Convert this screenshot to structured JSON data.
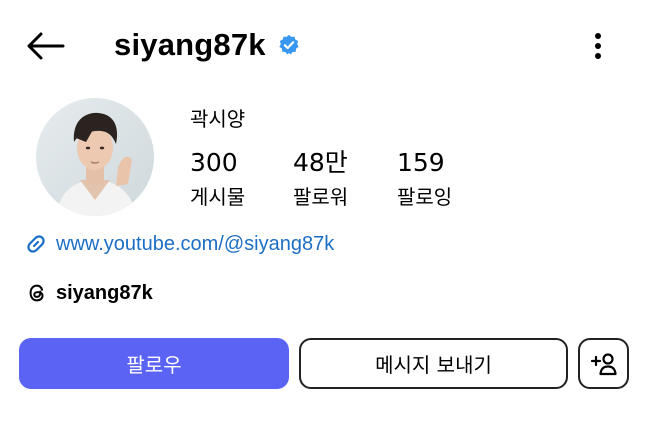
{
  "header": {
    "username": "siyang87k",
    "back_icon": "arrow-left-icon",
    "verified_icon": "verified-badge-icon",
    "more_icon": "more-vertical-icon"
  },
  "profile": {
    "display_name": "곽시양",
    "stats": [
      {
        "value": "300",
        "label": "게시물"
      },
      {
        "value": "48만",
        "label": "팔로워"
      },
      {
        "value": "159",
        "label": "팔로잉"
      }
    ],
    "link": "www.youtube.com/@siyang87k",
    "threads_handle": "siyang87k"
  },
  "actions": {
    "follow_label": "팔로우",
    "message_label": "메시지 보내기",
    "add_user_icon": "add-user-icon"
  },
  "colors": {
    "accent": "#5b63f5",
    "link": "#1d6fc5",
    "verified": "#3897f0",
    "text": "#000000",
    "background": "#ffffff"
  }
}
